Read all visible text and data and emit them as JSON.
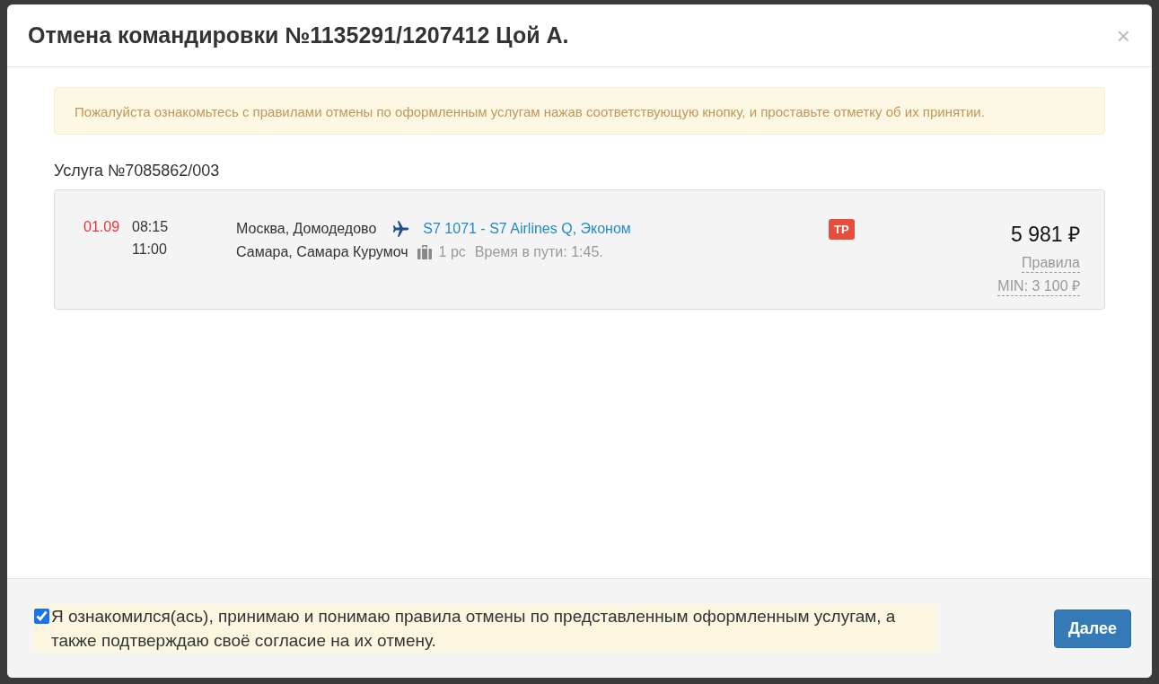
{
  "dialog": {
    "title": "Отмена командировки №1135291/1207412 Цой А.",
    "close": "×"
  },
  "notice": "Пожалуйста ознакомьтесь с правилами отмены по оформленным услугам нажав соответствующую кнопку, и проставьте отметку об их принятии.",
  "service": {
    "heading": "Услуга №7085862/003",
    "date": "01.09",
    "depart_time": "08:15",
    "arrive_time": "11:00",
    "from": "Москва, Домодедово",
    "to": "Самара, Самара Курумоч",
    "flight_link": "S7 1071 - S7 Airlines Q, Эконом",
    "baggage": "1 pc",
    "duration": "Время в пути: 1:45.",
    "badge": "TP",
    "price": "5 981 ₽",
    "rules_link": "Правила",
    "min_price": "MIN: 3 100 ₽"
  },
  "consent": {
    "text": "Я ознакомился(ась), принимаю и понимаю правила отмены по представленным оформленным услугам, а также подтверждаю своё согласие на их отмену.",
    "checked": true
  },
  "buttons": [
    {
      "label": "Далее",
      "kind": "primary"
    }
  ]
}
